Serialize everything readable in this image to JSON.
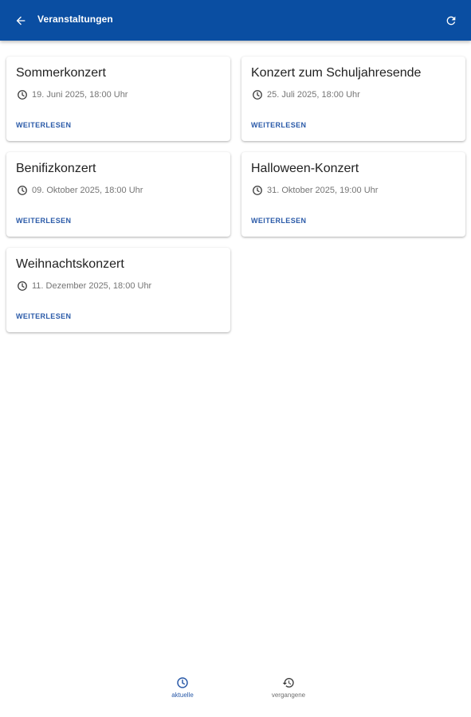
{
  "appbar": {
    "title": "Veranstaltungen",
    "back_icon": "arrow-back-icon",
    "refresh_icon": "refresh-icon",
    "color": "#0a4ea2"
  },
  "events": [
    {
      "title": "Sommerkonzert",
      "date": "19. Juni 2025, 18:00 Uhr",
      "link": "WEITERLESEN"
    },
    {
      "title": "Konzert zum Schuljahresende",
      "date": "25. Juli 2025, 18:00 Uhr",
      "link": "WEITERLESEN"
    },
    {
      "title": "Benifizkonzert",
      "date": "09. Oktober 2025, 18:00 Uhr",
      "link": "WEITERLESEN"
    },
    {
      "title": "Halloween-Konzert",
      "date": "31. Oktober 2025, 19:00 Uhr",
      "link": "WEITERLESEN"
    },
    {
      "title": "Weihnachtskonzert",
      "date": "11. Dezember 2025, 18:00 Uhr",
      "link": "WEITERLESEN"
    }
  ],
  "bottom_nav": {
    "items": [
      {
        "label": "aktuelle",
        "icon": "clock-icon",
        "active": true
      },
      {
        "label": "vergangene",
        "icon": "history-icon",
        "active": false
      }
    ],
    "accent": "#2a5aa8"
  }
}
